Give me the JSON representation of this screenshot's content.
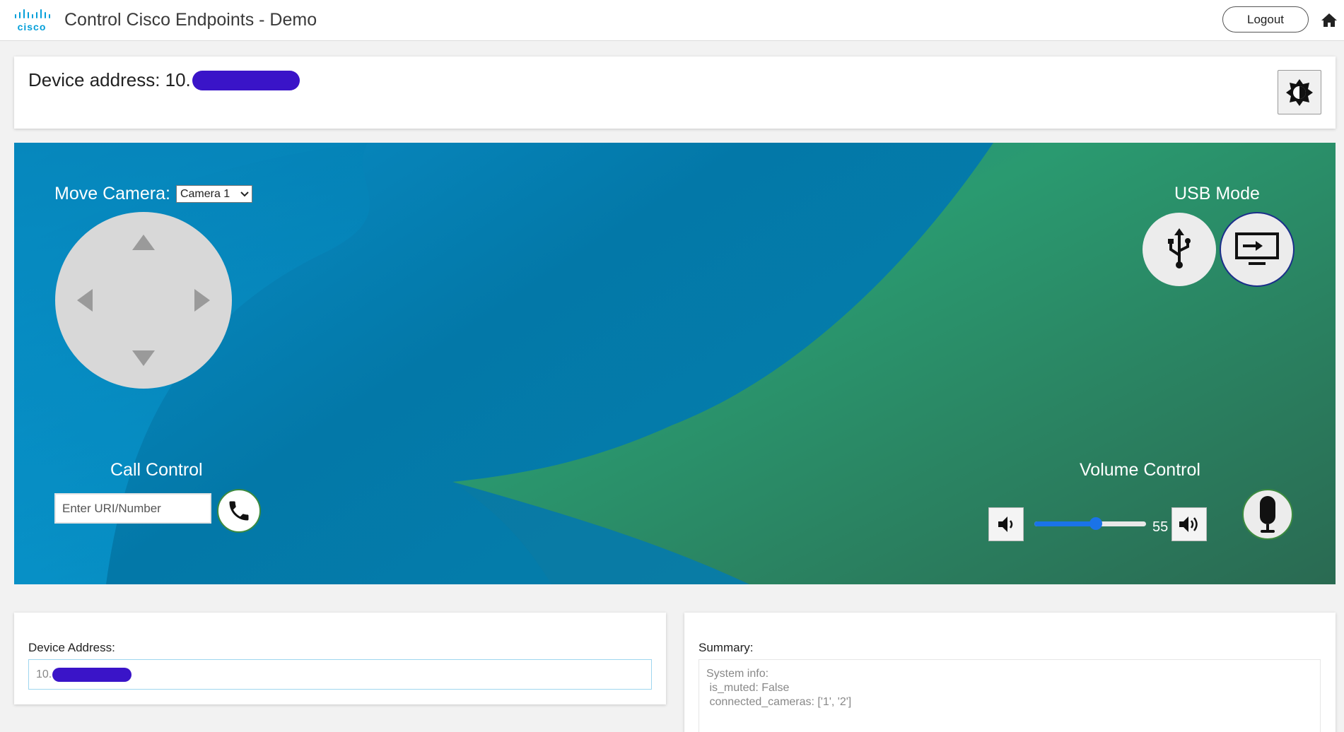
{
  "header": {
    "logo_text": "cisco",
    "title": "Control Cisco Endpoints - Demo",
    "logout_label": "Logout",
    "home_icon": "home-icon"
  },
  "device_card": {
    "label": "Device address: 10.",
    "brightness_icon": "brightness-icon"
  },
  "camera": {
    "label": "Move Camera:",
    "selected": "Camera 1",
    "arrows": [
      "up-arrow-icon",
      "down-arrow-icon",
      "left-arrow-icon",
      "right-arrow-icon"
    ]
  },
  "usb": {
    "title": "USB Mode",
    "usb_icon": "usb-icon",
    "screen_icon": "screen-input-icon"
  },
  "call": {
    "title": "Call Control",
    "placeholder": "Enter URI/Number",
    "call_icon": "phone-icon"
  },
  "volume": {
    "title": "Volume Control",
    "value": "55",
    "level": 0.55,
    "down_icon": "volume-down-icon",
    "up_icon": "volume-up-icon",
    "mic_icon": "microphone-icon"
  },
  "address_card": {
    "label": "Device Address:",
    "value_prefix": "10."
  },
  "summary_card": {
    "label": "Summary:",
    "text": "System info:\n is_muted: False\n connected_cameras: ['1', '2']"
  },
  "colors": {
    "cisco_blue": "#049fd9",
    "redaction": "#3a14c8",
    "hero_blue": "#0380b3",
    "hero_green": "#2c9a66",
    "slider_blue": "#1a73e8",
    "button_green_ring": "#3c8b40"
  }
}
